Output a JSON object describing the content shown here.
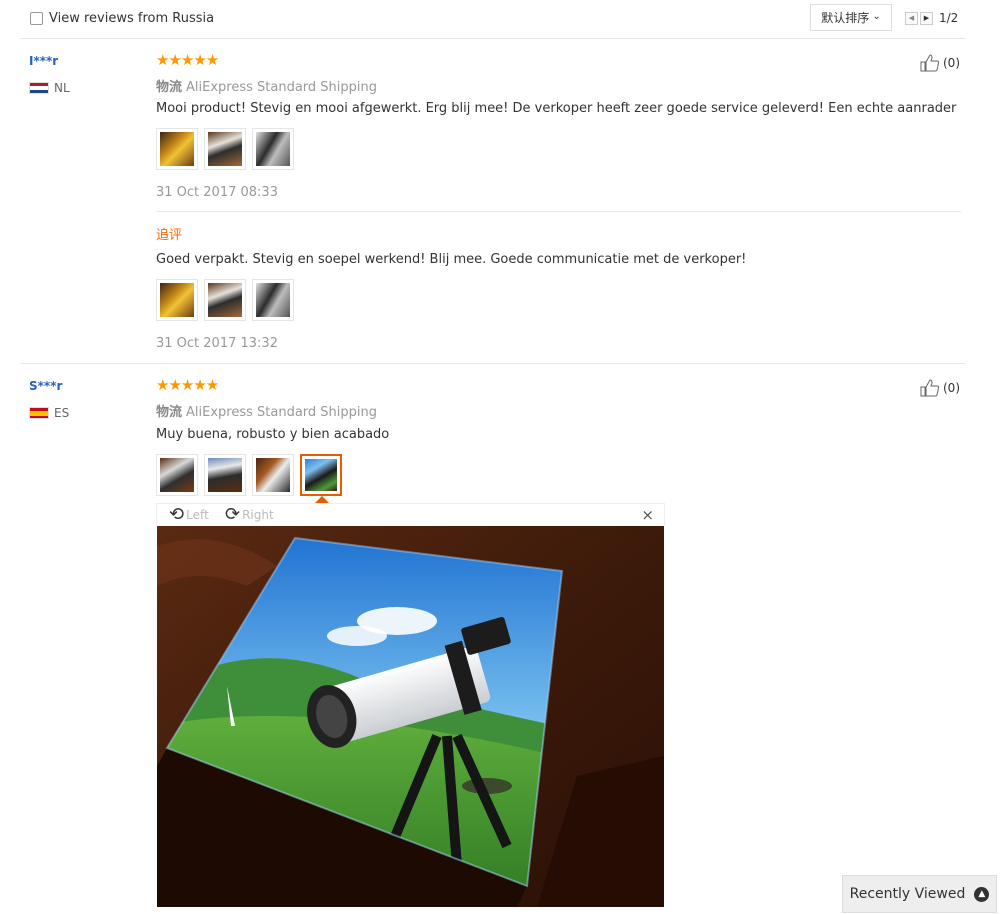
{
  "toolbar": {
    "filter_label": "View reviews from Russia",
    "sort_label": "默认排序",
    "page_indicator": "1/2"
  },
  "reviews": [
    {
      "user": "I***r",
      "country": "NL",
      "stars": "★★★★★",
      "shipping_prefix": "物流",
      "shipping": "AliExpress Standard Shipping",
      "text": "Mooi product! Stevig en mooi afgewerkt. Erg blij mee! De verkoper heeft zeer goede service geleverd! Een echte aanrader",
      "date": "31 Oct 2017 08:33",
      "likes": "(0)",
      "followup_title": "追评",
      "followup_text": "Goed verpakt. Stevig en soepel werkend! Blij mee. Goede communicatie met de verkoper!",
      "followup_date": "31 Oct 2017 13:32"
    },
    {
      "user": "S***r",
      "country": "ES",
      "stars": "★★★★★",
      "shipping_prefix": "物流",
      "shipping": "AliExpress Standard Shipping",
      "text": "Muy buena, robusto y bien acabado",
      "likes": "(0)"
    }
  ],
  "viewer": {
    "rotate_left": "Left",
    "rotate_right": "Right",
    "close": "×"
  },
  "recently_viewed": "Recently Viewed",
  "colors": {
    "accent": "#ff9900",
    "link": "#2a62bc",
    "highlight": "#e65c00"
  }
}
